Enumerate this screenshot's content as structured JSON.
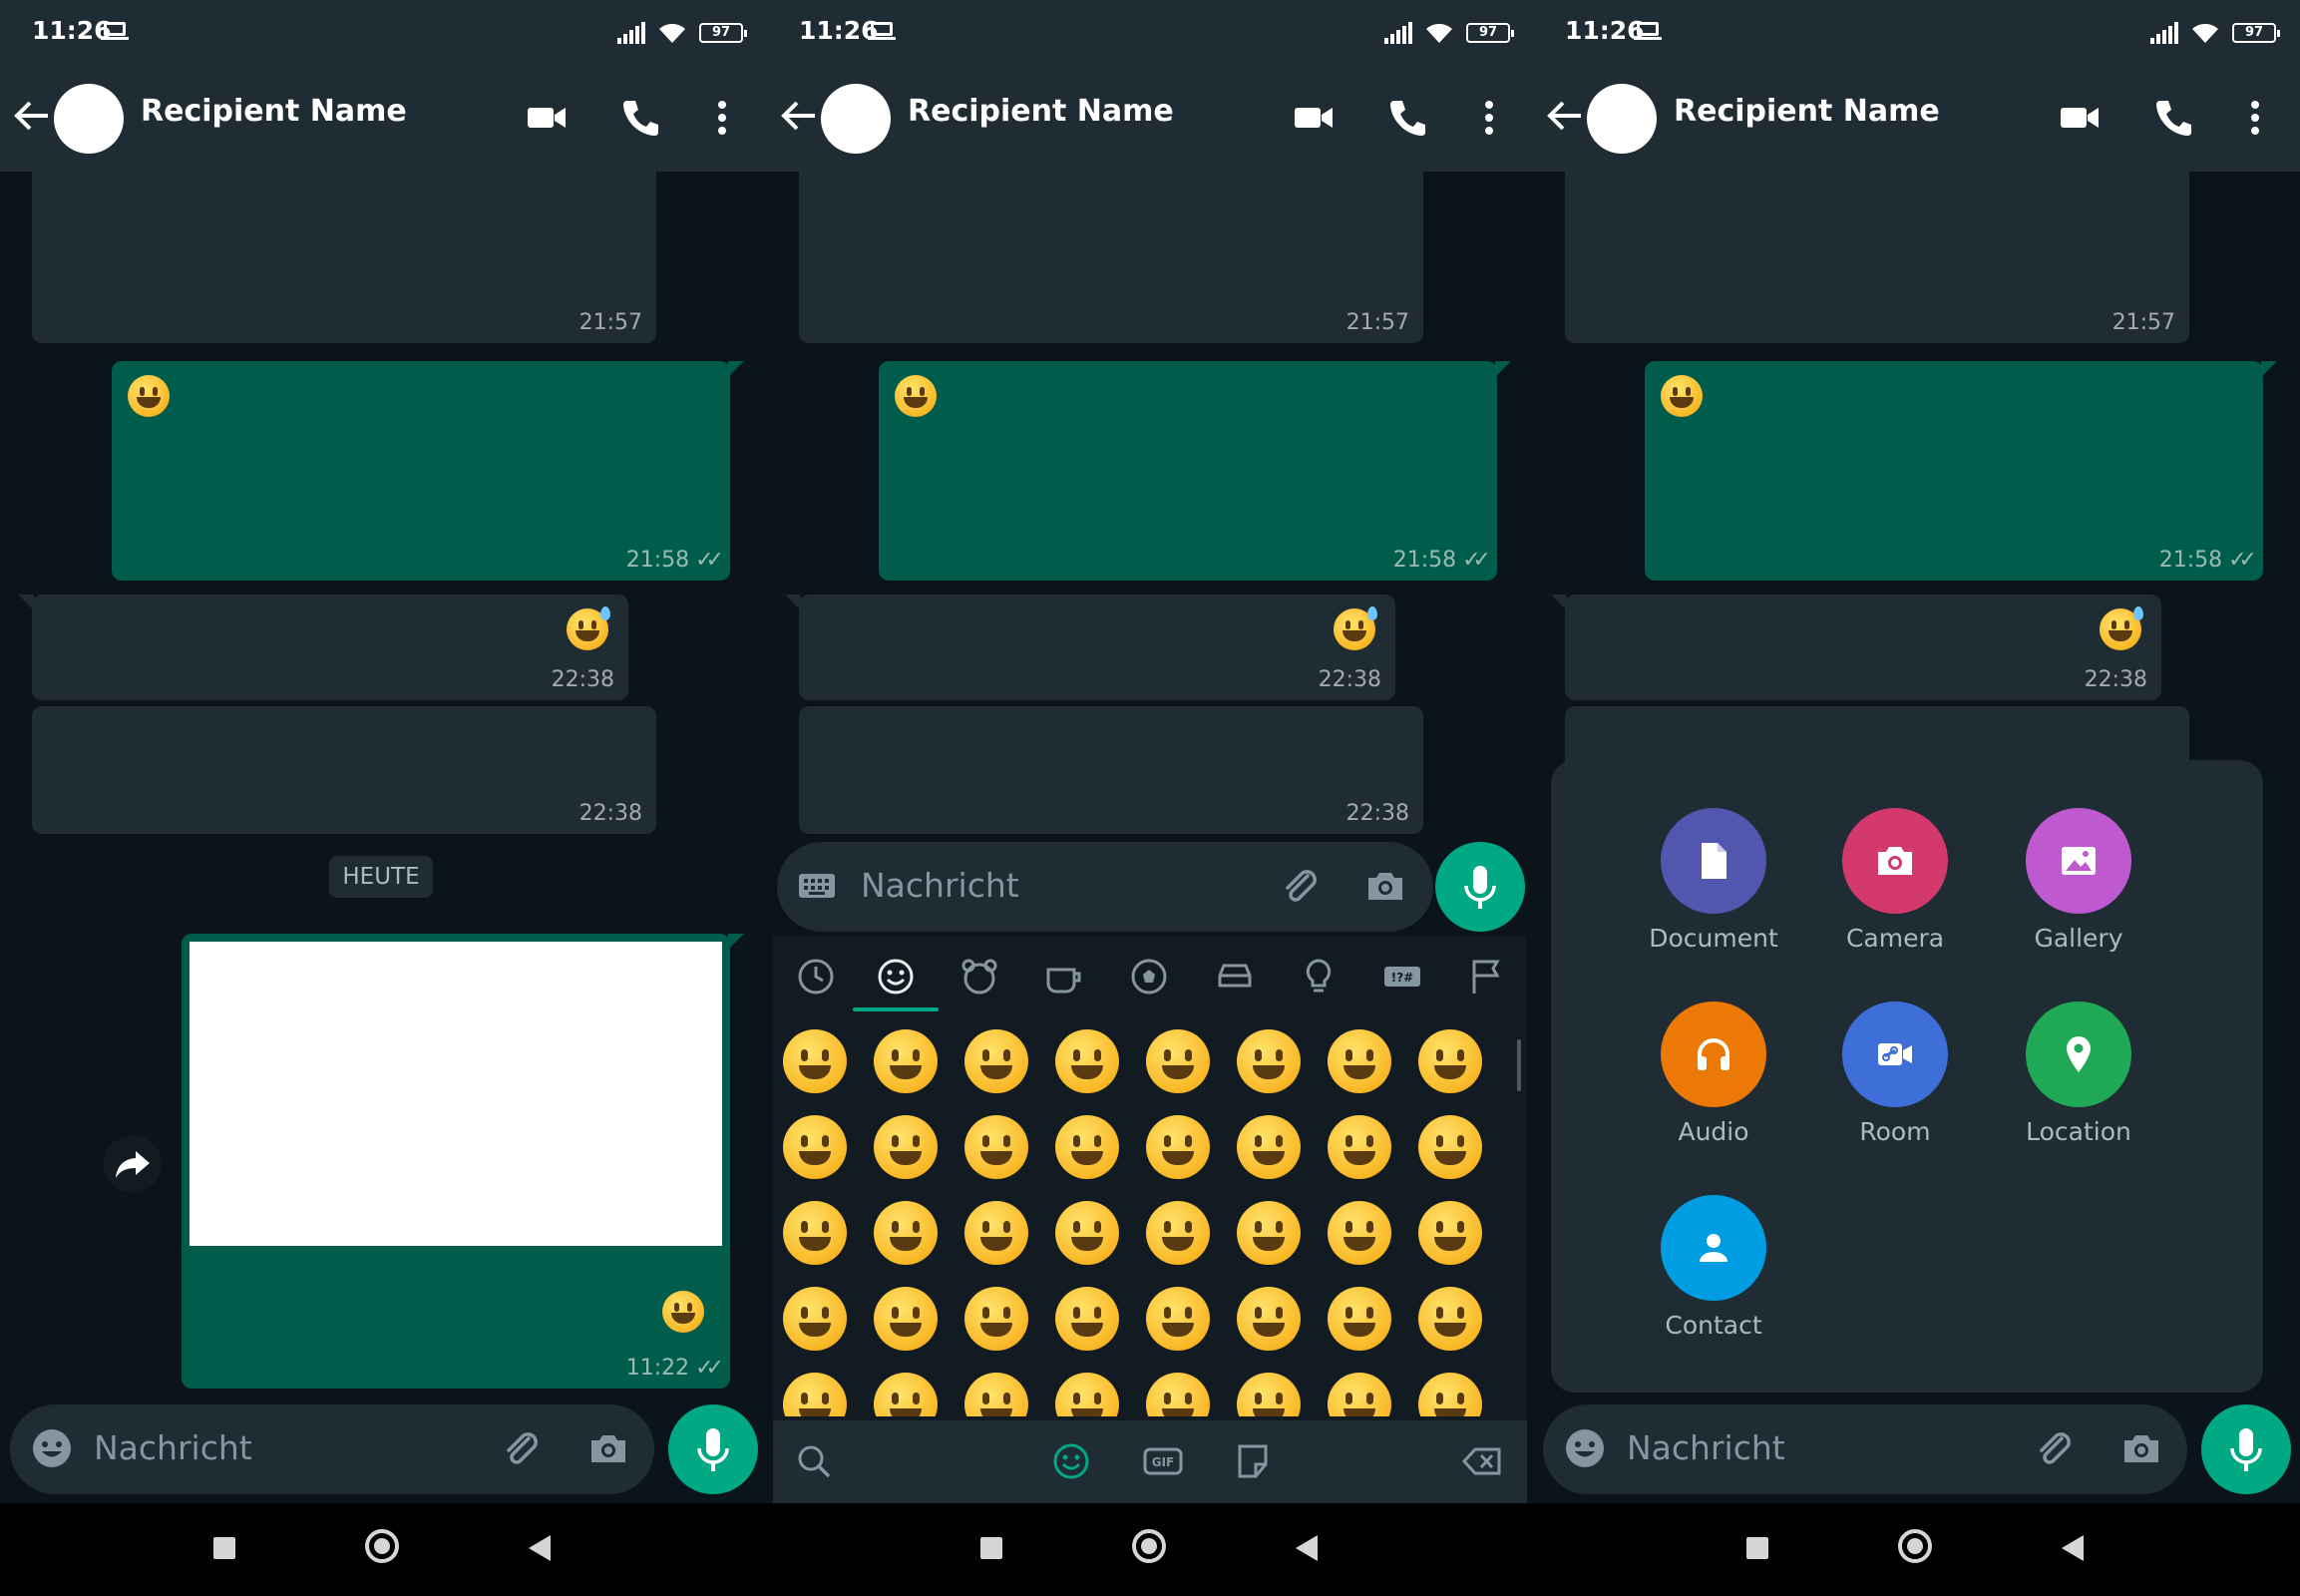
{
  "status_bar": {
    "time": "11:26",
    "battery": "97"
  },
  "chat": {
    "title": "Recipient Name"
  },
  "messages": {
    "m1_time": "21:57",
    "m2_time": "21:58",
    "m3_time": "22:38",
    "m4_time": "22:38",
    "day_label": "HEUTE",
    "m5_time": "11:22"
  },
  "input": {
    "placeholder": "Nachricht"
  },
  "attach_menu": {
    "items": [
      {
        "label": "Document",
        "color": "#5157ae",
        "icon": "document-icon"
      },
      {
        "label": "Camera",
        "color": "#d3396d",
        "icon": "camera-icon"
      },
      {
        "label": "Gallery",
        "color": "#bf59cf",
        "icon": "gallery-icon"
      },
      {
        "label": "Audio",
        "color": "#ec7905",
        "icon": "headphones-icon"
      },
      {
        "label": "Room",
        "color": "#3e6fd8",
        "icon": "video-link-icon"
      },
      {
        "label": "Location",
        "color": "#1fa855",
        "icon": "location-pin-icon"
      },
      {
        "label": "Contact",
        "color": "#009de2",
        "icon": "contact-icon"
      }
    ]
  },
  "colors": {
    "header": "#1f2c34",
    "incoming_bubble": "#202c33",
    "outgoing_bubble": "#005c4b",
    "accent": "#00a884"
  }
}
